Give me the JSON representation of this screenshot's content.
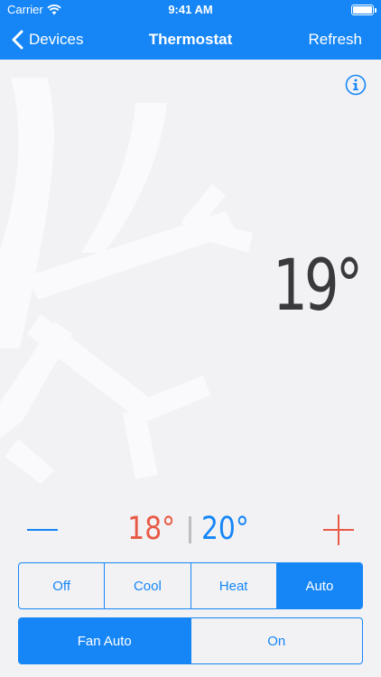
{
  "status_bar": {
    "carrier": "Carrier",
    "time": "9:41 AM"
  },
  "nav": {
    "back_label": "Devices",
    "title": "Thermostat",
    "refresh_label": "Refresh"
  },
  "current_temperature": "19°",
  "setpoints": {
    "heat": "18°",
    "cool": "20°"
  },
  "mode_control": {
    "options": [
      "Off",
      "Cool",
      "Heat",
      "Auto"
    ],
    "selected": "Auto"
  },
  "fan_control": {
    "options": [
      "Fan Auto",
      "On"
    ],
    "selected": "Fan Auto"
  },
  "colors": {
    "accent_blue": "#1686f7",
    "heat_red": "#e85a45",
    "background": "#f2f2f4",
    "snowflake": "#fafafc"
  },
  "icons": [
    "wifi-icon",
    "battery-icon",
    "back-chevron-icon",
    "info-icon",
    "snowflake-icon",
    "minus-icon",
    "plus-icon"
  ]
}
